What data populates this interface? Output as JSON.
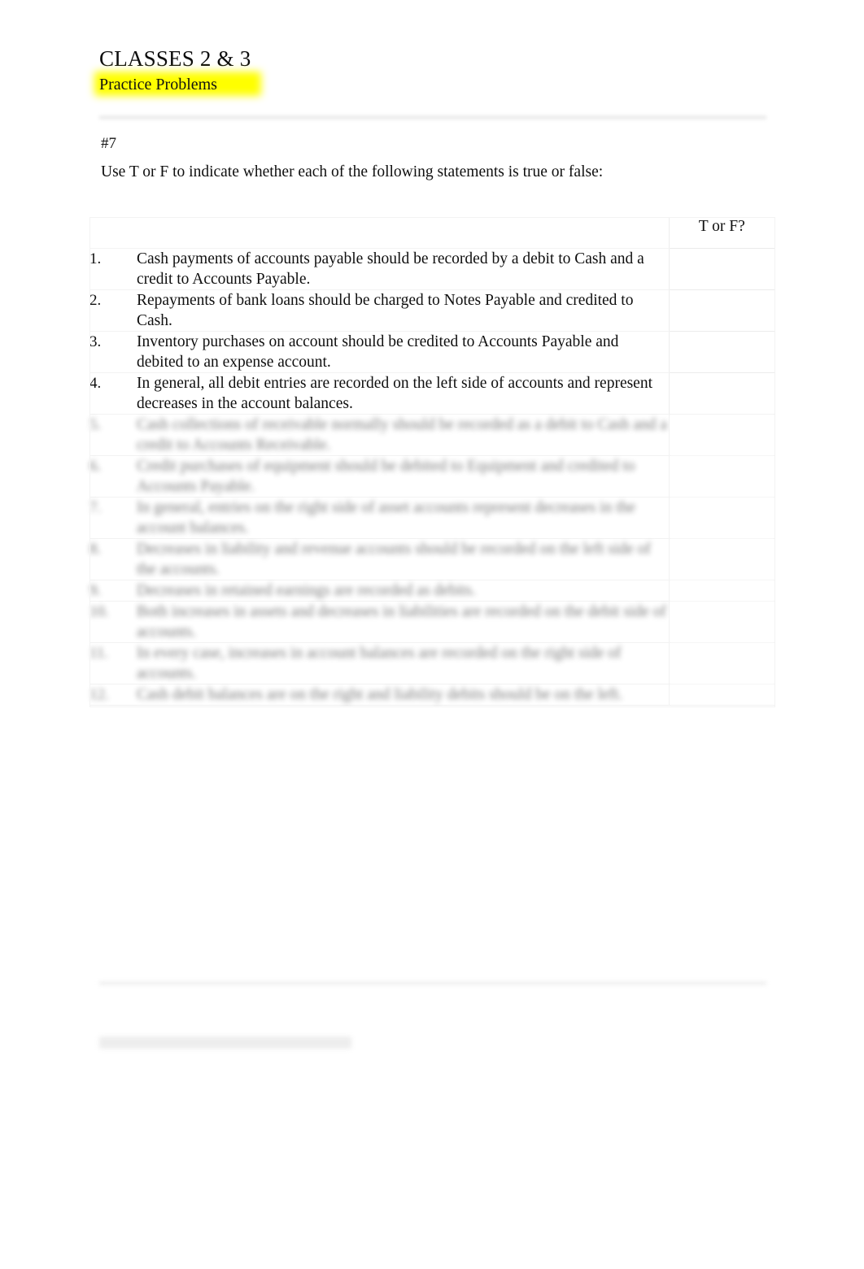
{
  "document": {
    "title": "CLASSES 2 & 3",
    "subtitle": "Practice Problems",
    "highlight_color": "#ffff00",
    "page_background": "#ffffff",
    "text_color": "#0f0f0f"
  },
  "question": {
    "number_label": "#7",
    "prompt": "Use T or F to indicate whether each of the following statements is true or false:"
  },
  "table": {
    "headers": {
      "number": "",
      "statement": "",
      "answer": "T or F?"
    },
    "rows": [
      {
        "number": "1.",
        "statement": "Cash payments of accounts payable should be recorded by a debit to Cash and a credit to Accounts Payable.",
        "answer": "",
        "legible": true
      },
      {
        "number": "2.",
        "statement": "Repayments of bank loans should be charged to Notes Payable and credited to Cash.",
        "answer": "",
        "legible": true
      },
      {
        "number": "3.",
        "statement": "Inventory purchases on account should be credited to Accounts Payable and debited to an expense account.",
        "answer": "",
        "legible": true
      },
      {
        "number": "4.",
        "statement": "In general, all debit entries are recorded on the left side of accounts and represent decreases in the account balances.",
        "answer": "",
        "legible": true
      },
      {
        "number": "5.",
        "statement": "Cash collections of receivable normally should be recorded as a debit to Cash and a credit to Accounts Receivable.",
        "answer": "",
        "legible": false
      },
      {
        "number": "6.",
        "statement": "Credit purchases of equipment should be debited to Equipment and credited to Accounts Payable.",
        "answer": "",
        "legible": false
      },
      {
        "number": "7.",
        "statement": "In general, entries on the right side of asset accounts represent decreases in the account balances.",
        "answer": "",
        "legible": false
      },
      {
        "number": "8.",
        "statement": "Decreases in liability and revenue accounts should be recorded on the left side of the accounts.",
        "answer": "",
        "legible": false
      },
      {
        "number": "9.",
        "statement": "Decreases in retained earnings are recorded as debits.",
        "answer": "",
        "legible": false
      },
      {
        "number": "10.",
        "statement": "Both increases in assets and decreases in liabilities are recorded on the debit side of accounts.",
        "answer": "",
        "legible": false
      },
      {
        "number": "11.",
        "statement": "In every case, increases in account balances are recorded on the right side of accounts.",
        "answer": "",
        "legible": false
      },
      {
        "number": "12.",
        "statement": "Cash debit balances are on the right and liability debits should be on the left.",
        "answer": "",
        "legible": false
      }
    ]
  },
  "footer": {
    "rule": "",
    "note": ""
  }
}
